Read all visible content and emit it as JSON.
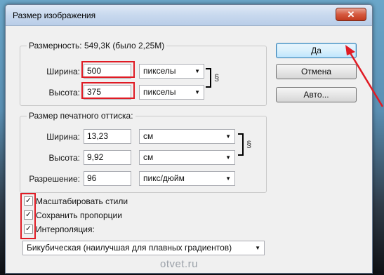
{
  "window": {
    "title": "Размер изображения",
    "close_glyph": "✕"
  },
  "pixel_dimensions": {
    "legend": "Размерность:  549,3К (было 2,25М)",
    "width": {
      "label": "Ширина:",
      "value": "500",
      "unit": "пикселы"
    },
    "height": {
      "label": "Высота:",
      "value": "375",
      "unit": "пикселы"
    }
  },
  "document_size": {
    "legend": "Размер печатного оттиска:",
    "width": {
      "label": "Ширина:",
      "value": "13,23",
      "unit": "см"
    },
    "height": {
      "label": "Высота:",
      "value": "9,92",
      "unit": "см"
    },
    "resolution": {
      "label": "Разрешение:",
      "value": "96",
      "unit": "пикс/дюйм"
    }
  },
  "buttons": {
    "ok": "Да",
    "cancel": "Отмена",
    "auto": "Авто..."
  },
  "options": {
    "scale_styles": {
      "label": "Масштабировать стили",
      "checked": true
    },
    "constrain": {
      "label": "Сохранить пропорции",
      "checked": true
    },
    "resample": {
      "label": "Интерполяция:",
      "checked": true
    },
    "resample_method": "Бикубическая (наилучшая для плавных градиентов)"
  },
  "icons": {
    "link": "chain-link-icon",
    "dropdown": "chevron-down-icon",
    "check": "checkmark-icon"
  },
  "check_glyph": "✓",
  "arrow_glyph": "▼",
  "link_glyph": "§",
  "watermark": "otvet.ru",
  "colors": {
    "highlight": "#e01b24",
    "default_button": "#3c7fb1"
  }
}
